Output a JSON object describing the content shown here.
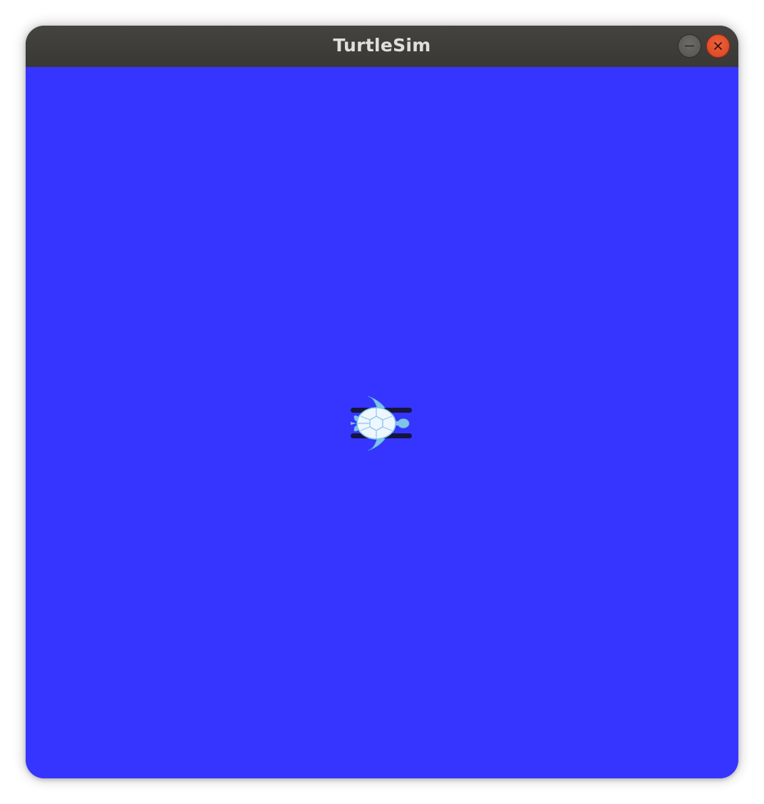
{
  "window": {
    "title": "TurtleSim",
    "minimize_icon": "minimize-icon",
    "close_icon": "close-icon"
  },
  "canvas": {
    "background_color": "#3535ff"
  },
  "turtle": {
    "icon": "turtle-icon",
    "shell_color": "#eef6ff",
    "limb_color": "#7fc4e8"
  }
}
